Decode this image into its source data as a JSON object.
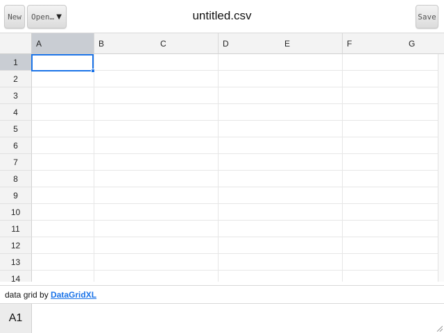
{
  "toolbar": {
    "new_label": "New",
    "open_label": "Open…",
    "open_caret": "▼",
    "save_label": "Save",
    "title": "untitled.csv"
  },
  "grid": {
    "columns": [
      "A",
      "B",
      "C",
      "D",
      "E",
      "F",
      "G"
    ],
    "rows": [
      "1",
      "2",
      "3",
      "4",
      "5",
      "6",
      "7",
      "8",
      "9",
      "10",
      "11",
      "12",
      "13",
      "14"
    ],
    "active_column": "A",
    "active_row": "1"
  },
  "credit": {
    "prefix": "data grid by ",
    "link_text": "DataGridXL"
  },
  "formula": {
    "cell_ref": "A1",
    "value": ""
  },
  "colors": {
    "accent": "#1a73e8",
    "header_bg": "#f3f3f3",
    "active_header_bg": "#c9cdd3"
  }
}
